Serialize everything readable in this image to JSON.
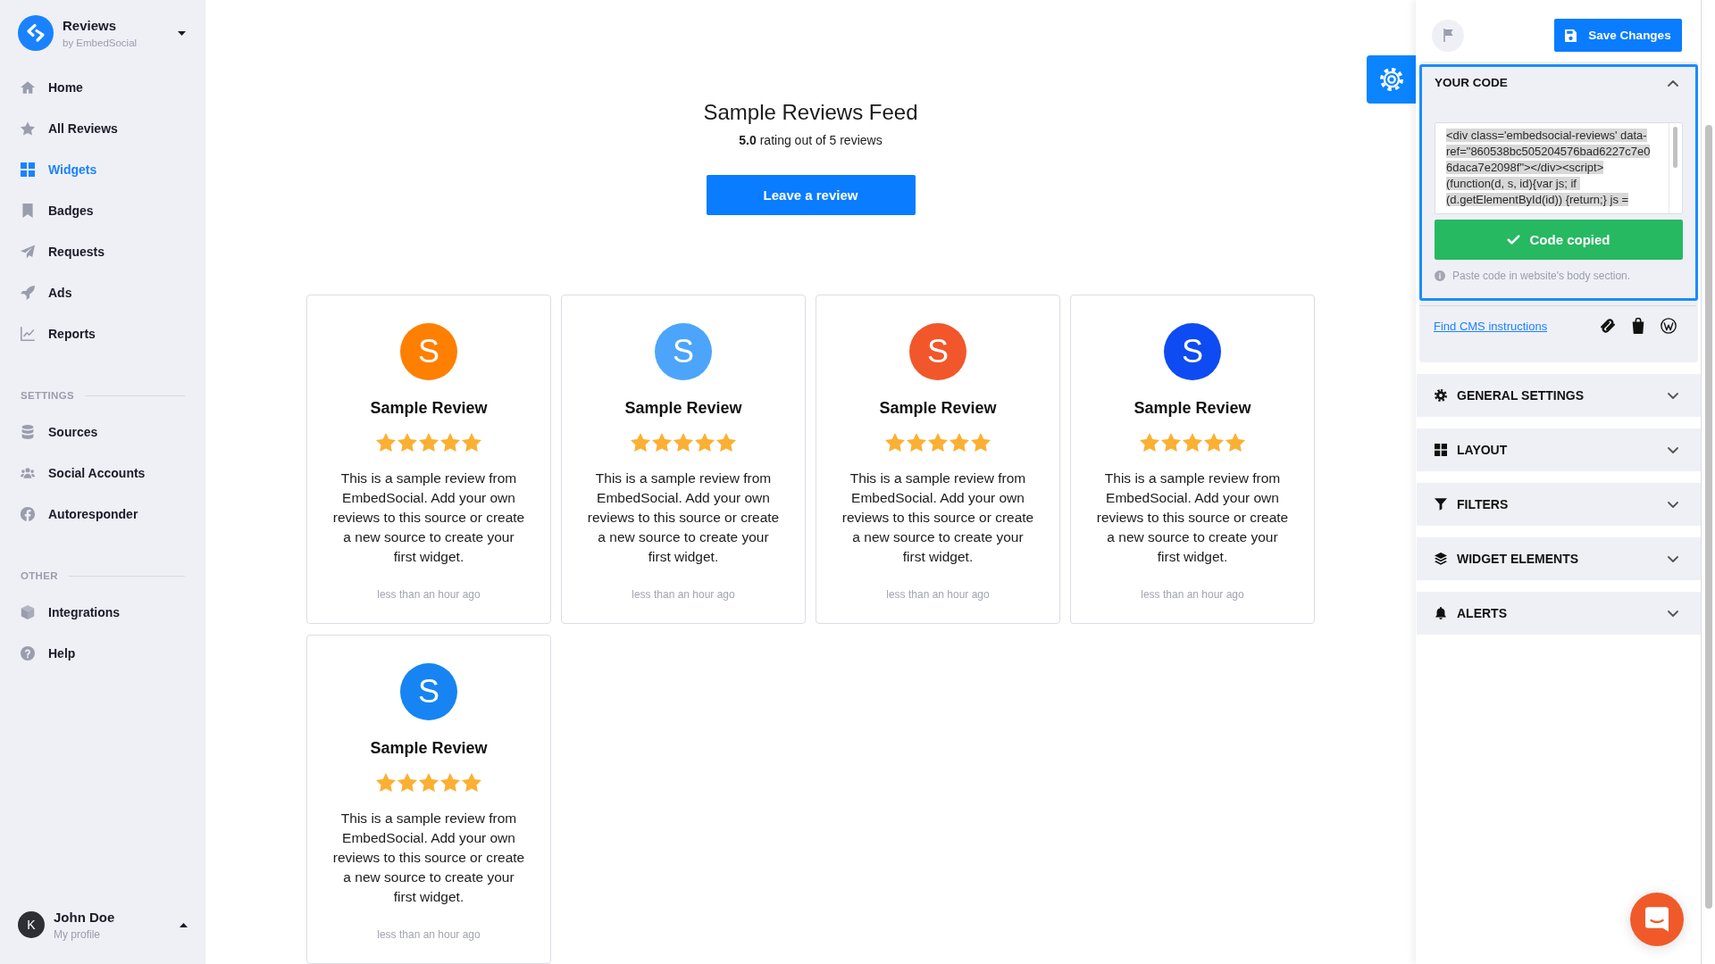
{
  "sidebar": {
    "brand": {
      "name": "Reviews",
      "byline": "by EmbedSocial"
    },
    "menu": [
      {
        "label": "Home",
        "selected": false
      },
      {
        "label": "All Reviews",
        "selected": false
      },
      {
        "label": "Widgets",
        "selected": true
      },
      {
        "label": "Badges",
        "selected": false
      },
      {
        "label": "Requests",
        "selected": false
      },
      {
        "label": "Ads",
        "selected": false
      },
      {
        "label": "Reports",
        "selected": false
      }
    ],
    "sections": [
      {
        "heading": "SETTINGS",
        "items": [
          {
            "label": "Sources",
            "selected": false
          },
          {
            "label": "Social Accounts",
            "selected": false
          },
          {
            "label": "Autoresponder",
            "selected": false
          }
        ]
      },
      {
        "heading": "OTHER",
        "items": [
          {
            "label": "Integrations",
            "selected": false
          },
          {
            "label": "Help",
            "selected": false
          }
        ]
      }
    ],
    "profile": {
      "initial": "K",
      "name": "John Doe",
      "link": "My profile"
    }
  },
  "feed": {
    "title": "Sample Reviews Feed",
    "summary": "**5.0** rating out of 5 reviews",
    "button": "Leave a review",
    "reviews": [
      {
        "initial": "S",
        "color": "#ff7f00",
        "title": "Sample Review",
        "stars": 5,
        "text": "This is a sample review from EmbedSocial. Add your own reviews to this source or create a new source to create your first widget.",
        "time": "less than an hour ago"
      },
      {
        "initial": "S",
        "color": "#4ca5fa",
        "title": "Sample Review",
        "stars": 5,
        "text": "This is a sample review from EmbedSocial. Add your own reviews to this source or create a new source to create your first widget.",
        "time": "less than an hour ago"
      },
      {
        "initial": "S",
        "color": "#f1572b",
        "title": "Sample Review",
        "stars": 5,
        "text": "This is a sample review from EmbedSocial. Add your own reviews to this source or create a new source to create your first widget.",
        "time": "less than an hour ago"
      },
      {
        "initial": "S",
        "color": "#0f4bf2",
        "title": "Sample Review",
        "stars": 5,
        "text": "This is a sample review from EmbedSocial. Add your own reviews to this source or create a new source to create your first widget.",
        "time": "less than an hour ago"
      },
      {
        "initial": "S",
        "color": "#1684f2",
        "title": "Sample Review",
        "stars": 5,
        "text": "This is a sample review from EmbedSocial. Add your own reviews to this source or create a new source to create your first widget.",
        "time": "less than an hour ago"
      }
    ]
  },
  "panel": {
    "save_button": "Save Changes",
    "code_section": {
      "title": "YOUR CODE",
      "expanded": true,
      "code": "<div class='embedsocial-reviews' data-ref=\"860538bc505204576bad6227c7e06daca7e2098f\"></div><script>\n(function(d, s, id){var js; if (d.getElementById(id)) {return;} js =",
      "highlighted": true,
      "copy_button": "Code copied",
      "hint": "Paste code in website's body section."
    },
    "cms_link": "Find CMS instructions",
    "sections": [
      {
        "title": "GENERAL SETTINGS",
        "expanded": false
      },
      {
        "title": "LAYOUT",
        "expanded": false
      },
      {
        "title": "FILTERS",
        "expanded": false
      },
      {
        "title": "WIDGET ELEMENTS",
        "expanded": false
      },
      {
        "title": "ALERTS",
        "expanded": false
      }
    ]
  }
}
